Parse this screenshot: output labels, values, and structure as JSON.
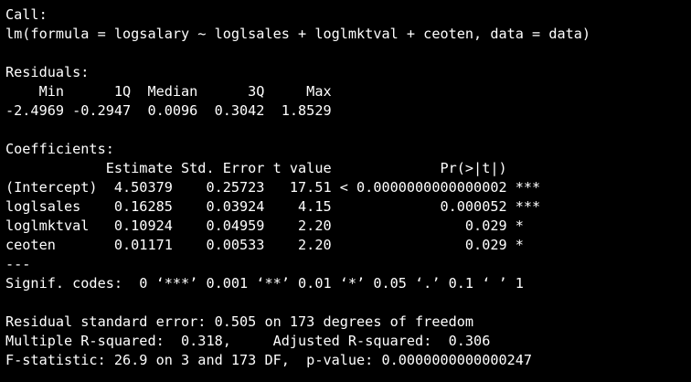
{
  "console": {
    "call_header": "Call:",
    "call_formula": "lm(formula = logsalary ~ loglsales + loglmktval + ceoten, data = data)",
    "residuals_header": "Residuals:",
    "residuals_labels": "    Min      1Q  Median      3Q     Max ",
    "residuals_values": "-2.4969 -0.2947  0.0096  0.3042  1.8529 ",
    "coefficients_header": "Coefficients:",
    "coef_table_header": "            Estimate Std. Error t value             Pr(>|t|)    ",
    "coef_rows": [
      "(Intercept)  4.50379    0.25723   17.51 < 0.0000000000000002 ***",
      "loglsales    0.16285    0.03924    4.15             0.000052 ***",
      "loglmktval   0.10924    0.04959    2.20                0.029 *  ",
      "ceoten       0.01171    0.00533    2.20                0.029 *  "
    ],
    "separator": "---",
    "signif_codes": "Signif. codes:  0 ‘***’ 0.001 ‘**’ 0.01 ‘*’ 0.05 ‘.’ 0.1 ‘ ’ 1",
    "residual_se": "Residual standard error: 0.505 on 173 degrees of freedom",
    "r_squared": "Multiple R-squared:  0.318,\tAdjusted R-squared:  0.306 ",
    "f_statistic": "F-statistic: 26.9 on 3 and 173 DF,  p-value: 0.0000000000000247"
  }
}
